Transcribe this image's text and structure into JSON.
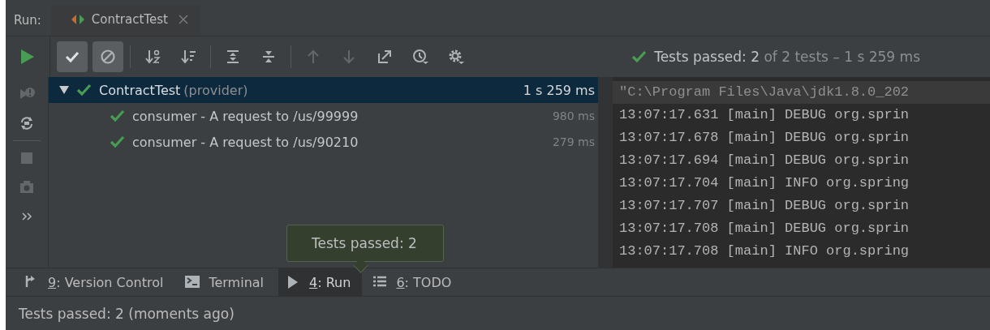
{
  "run_header": {
    "label": "Run:",
    "tabs": [
      {
        "label": "ContractTest",
        "selected": true,
        "closable": true
      }
    ]
  },
  "toolbar": {
    "buttons": [
      {
        "kind": "show-passed",
        "selected": true,
        "disabled": false
      },
      {
        "kind": "show-ignored",
        "selected": true,
        "disabled": false
      },
      {
        "kind": "sep"
      },
      {
        "kind": "sort-alpha",
        "selected": false,
        "disabled": false
      },
      {
        "kind": "sort-duration",
        "selected": false,
        "disabled": false
      },
      {
        "kind": "sep"
      },
      {
        "kind": "expand-all",
        "selected": false,
        "disabled": false
      },
      {
        "kind": "collapse-all",
        "selected": false,
        "disabled": false
      },
      {
        "kind": "sep"
      },
      {
        "kind": "prev",
        "disabled": true
      },
      {
        "kind": "next",
        "disabled": true
      },
      {
        "kind": "export",
        "selected": false,
        "disabled": false
      },
      {
        "kind": "history",
        "selected": false,
        "disabled": false
      },
      {
        "kind": "settings",
        "selected": false,
        "disabled": false
      }
    ]
  },
  "summary": {
    "passed": "Tests passed: 2",
    "rest": " of 2 tests – 1 s 259 ms"
  },
  "side_toolbar": [
    {
      "kind": "rerun-failed",
      "disabled": true
    },
    {
      "kind": "auto-test",
      "disabled": false
    },
    {
      "kind": "stop",
      "disabled": true
    },
    {
      "kind": "screenshot",
      "disabled": true
    },
    {
      "kind": "more",
      "disabled": false
    }
  ],
  "tree": [
    {
      "name": "ContractTest",
      "detail": "(provider)",
      "time": "1 s 259 ms",
      "passed": true,
      "selected": true,
      "expanded": true,
      "children": [
        {
          "name": "consumer - A request to /us/99999",
          "time": "980 ms",
          "passed": true,
          "selected": false
        },
        {
          "name": "consumer - A request to /us/90210",
          "time": "279 ms",
          "passed": true,
          "selected": false
        }
      ]
    }
  ],
  "console": [
    {
      "text": "\"C:\\Program Files\\Java\\jdk1.8.0_202",
      "highlighted": true
    },
    {
      "text": "13:07:17.631 [main] DEBUG org.sprin",
      "highlighted": false
    },
    {
      "text": "13:07:17.678 [main] DEBUG org.sprin",
      "highlighted": false
    },
    {
      "text": "13:07:17.694 [main] DEBUG org.sprin",
      "highlighted": false
    },
    {
      "text": "13:07:17.704 [main] INFO org.spring",
      "highlighted": false
    },
    {
      "text": "13:07:17.707 [main] DEBUG org.sprin",
      "highlighted": false
    },
    {
      "text": "13:07:17.708 [main] DEBUG org.sprin",
      "highlighted": false
    },
    {
      "text": "13:07:17.708 [main] INFO org.spring",
      "highlighted": false
    }
  ],
  "tooltip": {
    "text": "Tests passed: 2"
  },
  "tool_tabs": [
    {
      "kind": "vcs",
      "mnemonic": "9",
      "label": ": Version Control",
      "selected": false
    },
    {
      "kind": "terminal",
      "label": "Terminal",
      "selected": false
    },
    {
      "kind": "run",
      "mnemonic": "4",
      "label": ": Run",
      "selected": true
    },
    {
      "kind": "todo",
      "mnemonic": "6",
      "label": ": TODO",
      "selected": false
    }
  ],
  "status_bar": {
    "text": "Tests passed: 2 (moments ago)"
  }
}
